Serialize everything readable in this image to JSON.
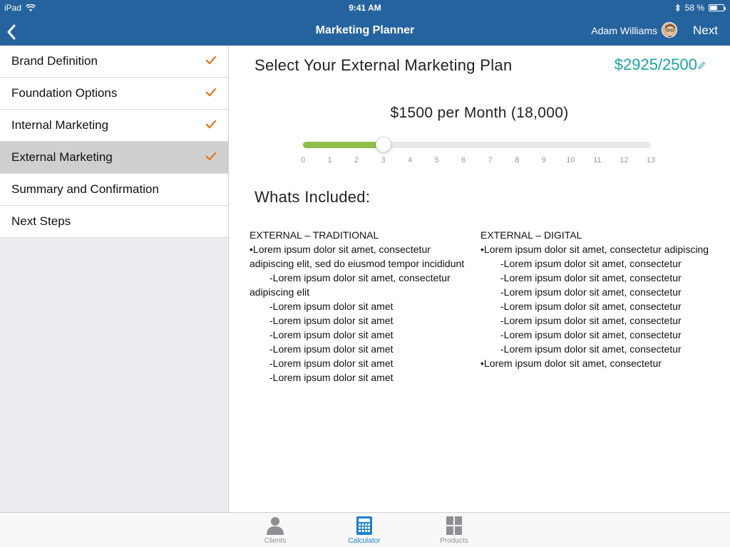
{
  "status_bar": {
    "device": "iPad",
    "time": "9:41 AM",
    "battery_percent": "58 %",
    "battery_level": 0.58
  },
  "nav": {
    "title": "Marketing Planner",
    "user_name": "Adam Williams",
    "next_label": "Next"
  },
  "sidebar": {
    "items": [
      {
        "label": "Brand Definition",
        "checked": true
      },
      {
        "label": "Foundation Options",
        "checked": true
      },
      {
        "label": "Internal Marketing",
        "checked": true
      },
      {
        "label": "External Marketing",
        "checked": true,
        "active": true
      },
      {
        "label": "Summary and Confirmation",
        "checked": false
      },
      {
        "label": "Next Steps",
        "checked": false
      }
    ]
  },
  "main": {
    "title": "Select Your External Marketing Plan",
    "budget": "$2925/2500",
    "price_label": "$1500 per Month (18,000)",
    "slider": {
      "value": 3,
      "min": 0,
      "max": 13
    },
    "ticks": [
      "0",
      "1",
      "2",
      "3",
      "4",
      "5",
      "6",
      "7",
      "8",
      "9",
      "10",
      "11",
      "12",
      "13"
    ],
    "included_title": "Whats Included:",
    "traditional": {
      "heading": "EXTERNAL – TRADITIONAL",
      "bullet1": "•Lorem ipsum dolor sit amet, consectetur adipiscing elit, sed do eiusmod tempor incididunt",
      "sub_first_a": "-Lorem ipsum dolor sit amet, consectetur",
      "sub_first_b": "adipiscing elit",
      "subs": [
        "-Lorem ipsum dolor sit amet",
        "-Lorem ipsum dolor sit amet",
        "-Lorem ipsum dolor sit amet",
        "-Lorem ipsum dolor sit amet",
        "-Lorem ipsum dolor sit amet",
        "-Lorem ipsum dolor sit amet"
      ]
    },
    "digital": {
      "heading": "EXTERNAL – DIGITAL",
      "bullet1": "•Lorem ipsum dolor sit amet, consectetur adipiscing",
      "subs": [
        "-Lorem ipsum dolor sit amet, consectetur",
        "-Lorem ipsum dolor sit amet, consectetur",
        "-Lorem ipsum dolor sit amet, consectetur",
        "-Lorem ipsum dolor sit amet, consectetur",
        "-Lorem ipsum dolor sit amet, consectetur",
        "-Lorem ipsum dolor sit amet, consectetur",
        "-Lorem ipsum dolor sit amet, consectetur"
      ],
      "bullet2": "•Lorem ipsum dolor sit amet, consectetur"
    }
  },
  "tab_bar": {
    "tabs": [
      {
        "label": "Clients",
        "icon": "person-icon",
        "active": false
      },
      {
        "label": "Calculator",
        "icon": "calculator-icon",
        "active": true
      },
      {
        "label": "Products",
        "icon": "grid-icon",
        "active": false
      }
    ]
  },
  "colors": {
    "nav_blue": "#25639e",
    "check_orange": "#e07b2a",
    "budget_teal": "#1aa3a3",
    "slider_green": "#8fbf4a",
    "tab_active_blue": "#1a7fd1"
  }
}
